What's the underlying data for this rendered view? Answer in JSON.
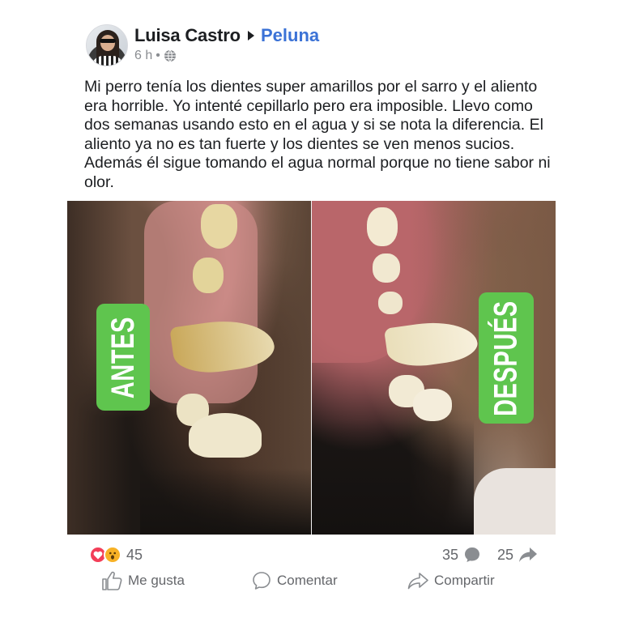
{
  "post": {
    "author": "Luisa Castro",
    "group": "Peluna",
    "time": "6 h",
    "separator": "•",
    "body": "Mi perro tenía los dientes super amarillos por el sarro y el aliento era horrible. Yo intenté cepillarlo pero era imposible. Llevo como dos semanas usando esto en el agua y si se nota la diferencia. El aliento ya no es tan fuerte y los dientes se ven menos sucios. Además él sigue tomando el agua normal porque no tiene sabor ni olor.",
    "image": {
      "label_before": "ANTES",
      "label_after": "DESPUÉS"
    }
  },
  "stats": {
    "reactions_count": "45",
    "comments_count": "35",
    "shares_count": "25"
  },
  "actions": {
    "like": "Me gusta",
    "comment": "Comentar",
    "share": "Compartir"
  },
  "colors": {
    "group_link": "#3b72d6",
    "tag_green": "#5fc54e",
    "muted_text": "#65676b"
  },
  "icons": [
    "globe-icon",
    "heart-reaction-icon",
    "wow-reaction-icon",
    "comment-bubble-icon",
    "share-arrow-icon",
    "like-thumb-icon",
    "comment-icon",
    "share-icon"
  ]
}
